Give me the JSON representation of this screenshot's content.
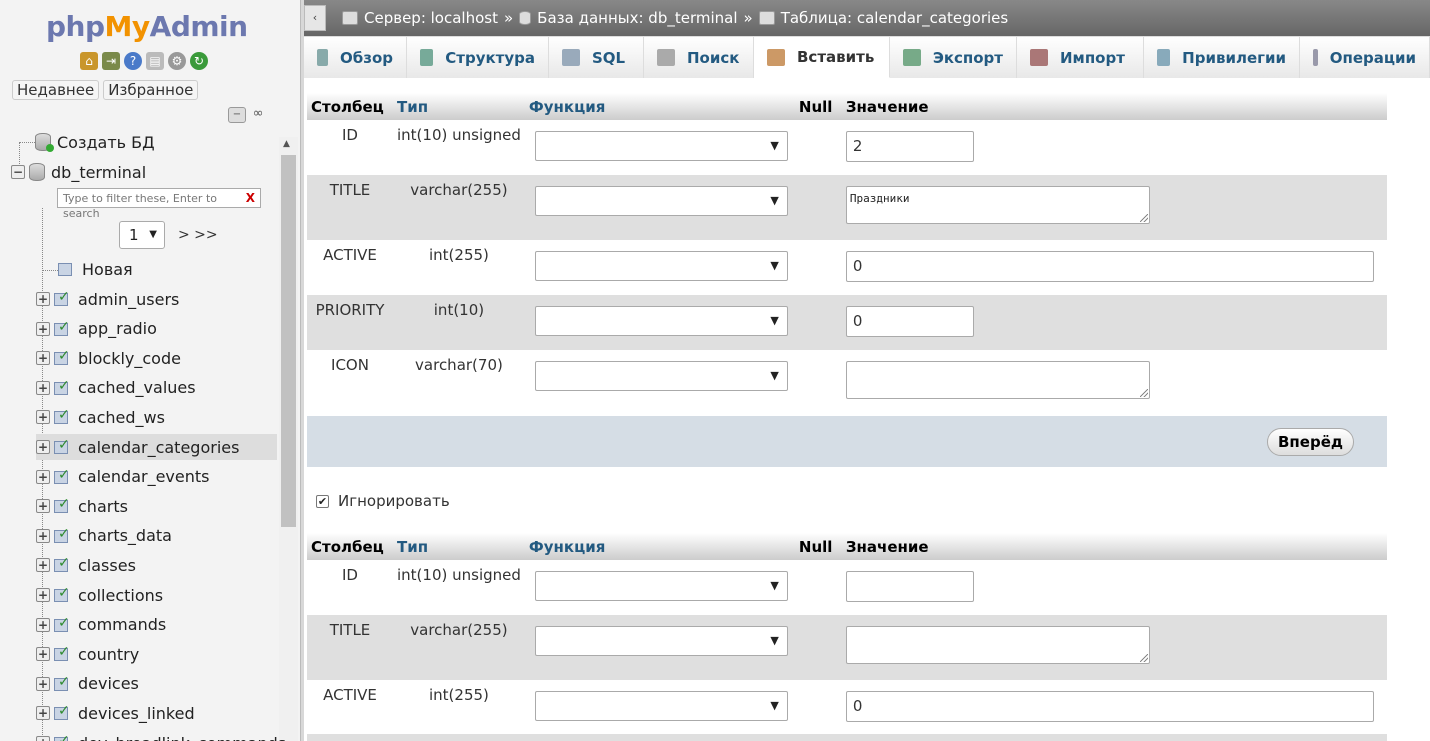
{
  "logo": {
    "php": "php",
    "my": "My",
    "admin": "Admin"
  },
  "sidebar": {
    "recent_label": "Недавнее",
    "favorites_label": "Избранное",
    "create_db_label": "Создать БД",
    "db_name": "db_terminal",
    "filter_placeholder": "Type to filter these, Enter to search",
    "filter_clear": "X",
    "page_value": "1",
    "page_next": "> >>",
    "new_label": "Новая",
    "tables": [
      "admin_users",
      "app_radio",
      "blockly_code",
      "cached_values",
      "cached_ws",
      "calendar_categories",
      "calendar_events",
      "charts",
      "charts_data",
      "classes",
      "collections",
      "commands",
      "country",
      "devices",
      "devices_linked",
      "dev_broadlink_commands"
    ],
    "selected_table": "calendar_categories"
  },
  "topbar": {
    "toggle": "‹",
    "server": "Сервер: localhost",
    "database": "База данных: db_terminal",
    "table": "Таблица: calendar_categories",
    "sep": "»"
  },
  "tabs": [
    "Обзор",
    "Структура",
    "SQL",
    "Поиск",
    "Вставить",
    "Экспорт",
    "Импорт",
    "Привилегии",
    "Операции"
  ],
  "active_tab": "Вставить",
  "headers": {
    "column": "Столбец",
    "type": "Тип",
    "function": "Функция",
    "null": "Null",
    "value": "Значение"
  },
  "form1": [
    {
      "column": "ID",
      "type": "int(10) unsigned",
      "value": "2",
      "kind": "short"
    },
    {
      "column": "TITLE",
      "type": "varchar(255)",
      "value": "Праздники",
      "kind": "textarea"
    },
    {
      "column": "ACTIVE",
      "type": "int(255)",
      "value": "0",
      "kind": "long"
    },
    {
      "column": "PRIORITY",
      "type": "int(10)",
      "value": "0",
      "kind": "short"
    },
    {
      "column": "ICON",
      "type": "varchar(70)",
      "value": "",
      "kind": "textarea"
    }
  ],
  "submit_label": "Вперёд",
  "ignore_label": "Игнорировать",
  "ignore_checked": "✔",
  "form2": [
    {
      "column": "ID",
      "type": "int(10) unsigned",
      "value": "",
      "kind": "short"
    },
    {
      "column": "TITLE",
      "type": "varchar(255)",
      "value": "",
      "kind": "textarea"
    },
    {
      "column": "ACTIVE",
      "type": "int(255)",
      "value": "0",
      "kind": "long"
    }
  ],
  "select_arrow": "▼",
  "colors": {
    "accent": "#235a81",
    "topbar": "#777777",
    "submit_row": "#d5dde5"
  }
}
